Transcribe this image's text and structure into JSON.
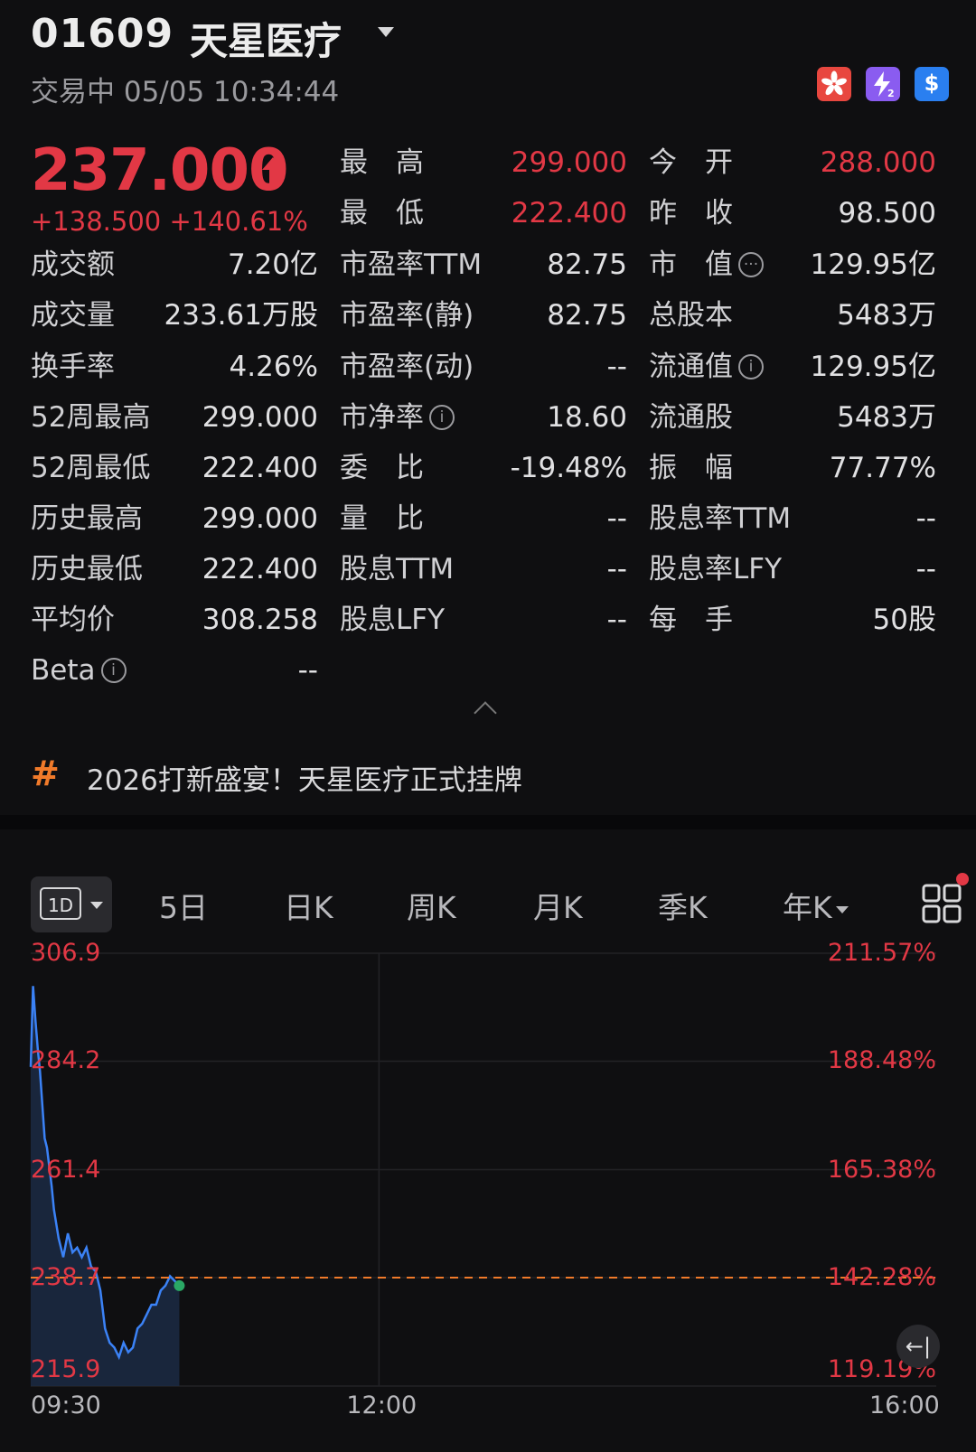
{
  "header": {
    "code": "01609",
    "name": "天星医疗",
    "status": "交易中 05/05 10:34:44",
    "badges": [
      {
        "icon": "hk-flag-icon",
        "color": "#e8473f"
      },
      {
        "icon": "z2-icon",
        "label": "Z2",
        "color": "#8a5cf0"
      },
      {
        "icon": "dollar-icon",
        "label": "$",
        "color": "#2a7ff0"
      }
    ]
  },
  "quote": {
    "price": "237.000",
    "change": "+138.500",
    "change_pct": "+140.61%",
    "up_color": "#e23845"
  },
  "stats": {
    "col2_top": [
      {
        "label": "最　高",
        "value": "299.000"
      },
      {
        "label": "最　低",
        "value": "222.400"
      }
    ],
    "col3_top": [
      {
        "label": "今　开",
        "value": "288.000"
      },
      {
        "label": "昨　收",
        "value": "98.500"
      }
    ],
    "col1": [
      {
        "label": "成交额",
        "value": "7.20亿"
      },
      {
        "label": "成交量",
        "value": "233.61万股"
      },
      {
        "label": "换手率",
        "value": "4.26%"
      },
      {
        "label": "52周最高",
        "value": "299.000"
      },
      {
        "label": "52周最低",
        "value": "222.400"
      },
      {
        "label": "历史最高",
        "value": "299.000"
      },
      {
        "label": "历史最低",
        "value": "222.400"
      },
      {
        "label": "平均价",
        "value": "308.258"
      },
      {
        "label": "Beta",
        "value": "--"
      }
    ],
    "col2": [
      {
        "label": "市盈率TTM",
        "value": "82.75"
      },
      {
        "label": "市盈率(静)",
        "value": "82.75"
      },
      {
        "label": "市盈率(动)",
        "value": "--"
      },
      {
        "label": "市净率",
        "value": "18.60"
      },
      {
        "label": "委　比",
        "value": "-19.48%"
      },
      {
        "label": "量　比",
        "value": "--"
      },
      {
        "label": "股息TTM",
        "value": "--"
      },
      {
        "label": "股息LFY",
        "value": "--"
      }
    ],
    "col3": [
      {
        "label": "市　值",
        "value": "129.95亿"
      },
      {
        "label": "总股本",
        "value": "5483万"
      },
      {
        "label": "流通值",
        "value": "129.95亿"
      },
      {
        "label": "流通股",
        "value": "5483万"
      },
      {
        "label": "振　幅",
        "value": "77.77%"
      },
      {
        "label": "股息率TTM",
        "value": "--"
      },
      {
        "label": "股息率LFY",
        "value": "--"
      },
      {
        "label": "每　手",
        "value": "50股"
      }
    ]
  },
  "news": {
    "icon": "hashtag-icon",
    "text": "2026打新盛宴！天星医疗正式挂牌"
  },
  "tabs": {
    "selected": "1D",
    "items": [
      "5日",
      "日K",
      "周K",
      "月K",
      "季K",
      "年K"
    ]
  },
  "chart_data": {
    "type": "line",
    "y_ticks": [
      "306.9",
      "284.2",
      "261.4",
      "238.7",
      "215.9"
    ],
    "y_pct_ticks": [
      "211.57%",
      "188.48%",
      "165.38%",
      "142.28%",
      "119.19%"
    ],
    "x_ticks": [
      "09:30",
      "12:00",
      "16:00"
    ],
    "ylim": [
      215.9,
      306.9
    ],
    "reference_line": 238.7,
    "line_color": "#3b82f6",
    "ref_color": "#f07a2a",
    "series": [
      {
        "x_minutes_from_open": [
          0,
          1,
          2,
          3,
          4,
          5,
          6,
          7,
          8,
          9,
          10,
          12,
          14,
          16,
          18,
          20,
          22,
          24,
          26,
          28,
          30,
          32,
          34,
          36,
          38,
          40,
          42,
          44,
          46,
          48,
          50,
          52,
          54,
          56,
          58,
          60,
          62,
          64
        ],
        "values": [
          283,
          300,
          293,
          287,
          282,
          275,
          268,
          266,
          262,
          258,
          253,
          247,
          243,
          248,
          244,
          245,
          243,
          245,
          241,
          240,
          236,
          228,
          225,
          224,
          222,
          225,
          223,
          224,
          228,
          229,
          231,
          233,
          233,
          236,
          237,
          239,
          238,
          237
        ]
      }
    ]
  }
}
